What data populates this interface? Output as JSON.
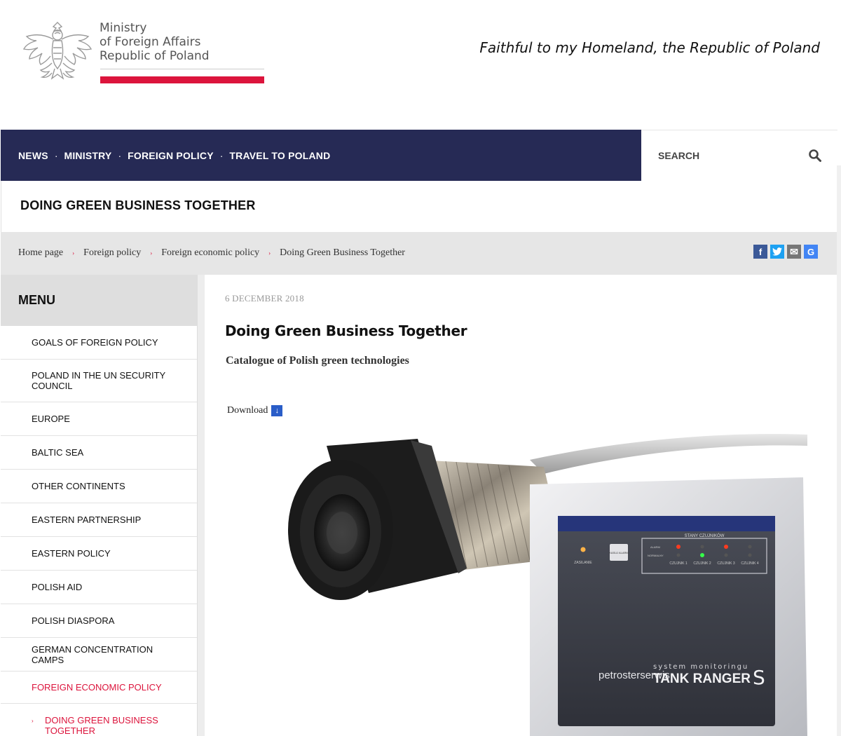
{
  "header": {
    "logo_lines": [
      "Ministry",
      "of Foreign Affairs",
      "Republic of Poland"
    ],
    "motto": "Faithful to my Homeland, the Republic of Poland"
  },
  "nav": {
    "items": [
      "NEWS",
      "MINISTRY",
      "FOREIGN POLICY",
      "TRAVEL TO POLAND"
    ],
    "separator": "·",
    "search_placeholder": "SEARCH"
  },
  "page": {
    "title": "DOING GREEN BUSINESS TOGETHER"
  },
  "breadcrumb": {
    "items": [
      "Home page",
      "Foreign policy",
      "Foreign economic policy",
      "Doing Green Business Together"
    ],
    "separator": "›"
  },
  "share": {
    "facebook": "f",
    "twitter": "t",
    "email": "✉",
    "google": "G"
  },
  "sidebar": {
    "heading": "MENU",
    "items": [
      "GOALS OF FOREIGN POLICY",
      "POLAND IN THE UN SECURITY COUNCIL",
      "EUROPE",
      "BALTIC SEA",
      "OTHER CONTINENTS",
      "EASTERN PARTNERSHIP",
      "EASTERN POLICY",
      "POLISH AID",
      "POLISH DIASPORA",
      "GERMAN CONCENTRATION CAMPS",
      "FOREIGN ECONOMIC POLICY"
    ],
    "sub_item": "DOING GREEN BUSINESS TOGETHER"
  },
  "article": {
    "date": "6 DECEMBER 2018",
    "title": "Doing Green Business Together",
    "subtitle": "Catalogue of Polish green technologies",
    "download_label": "Download",
    "download_icon": "↓"
  },
  "photo": {
    "panel_heading": "STANY CZUJNIKÓW",
    "row_alarm": "ALARM",
    "row_normal": "NORMALNY",
    "sensors": [
      "CZUJNIK 1",
      "CZUJNIK 2",
      "CZUJNIK 3",
      "CZUJNIK 4"
    ],
    "power_label": "ZASILANIE",
    "button_label": "KASUJ ALARM",
    "brand": "petrosterserwis",
    "system_label": "system monitoringu",
    "product": "TANK RANGER",
    "product_suffix": "S"
  },
  "colors": {
    "nav_bg": "#262a55",
    "accent_red": "#dc143c",
    "facebook": "#3b5998",
    "twitter": "#1da1f2",
    "email": "#777777",
    "google": "#4285f4"
  }
}
